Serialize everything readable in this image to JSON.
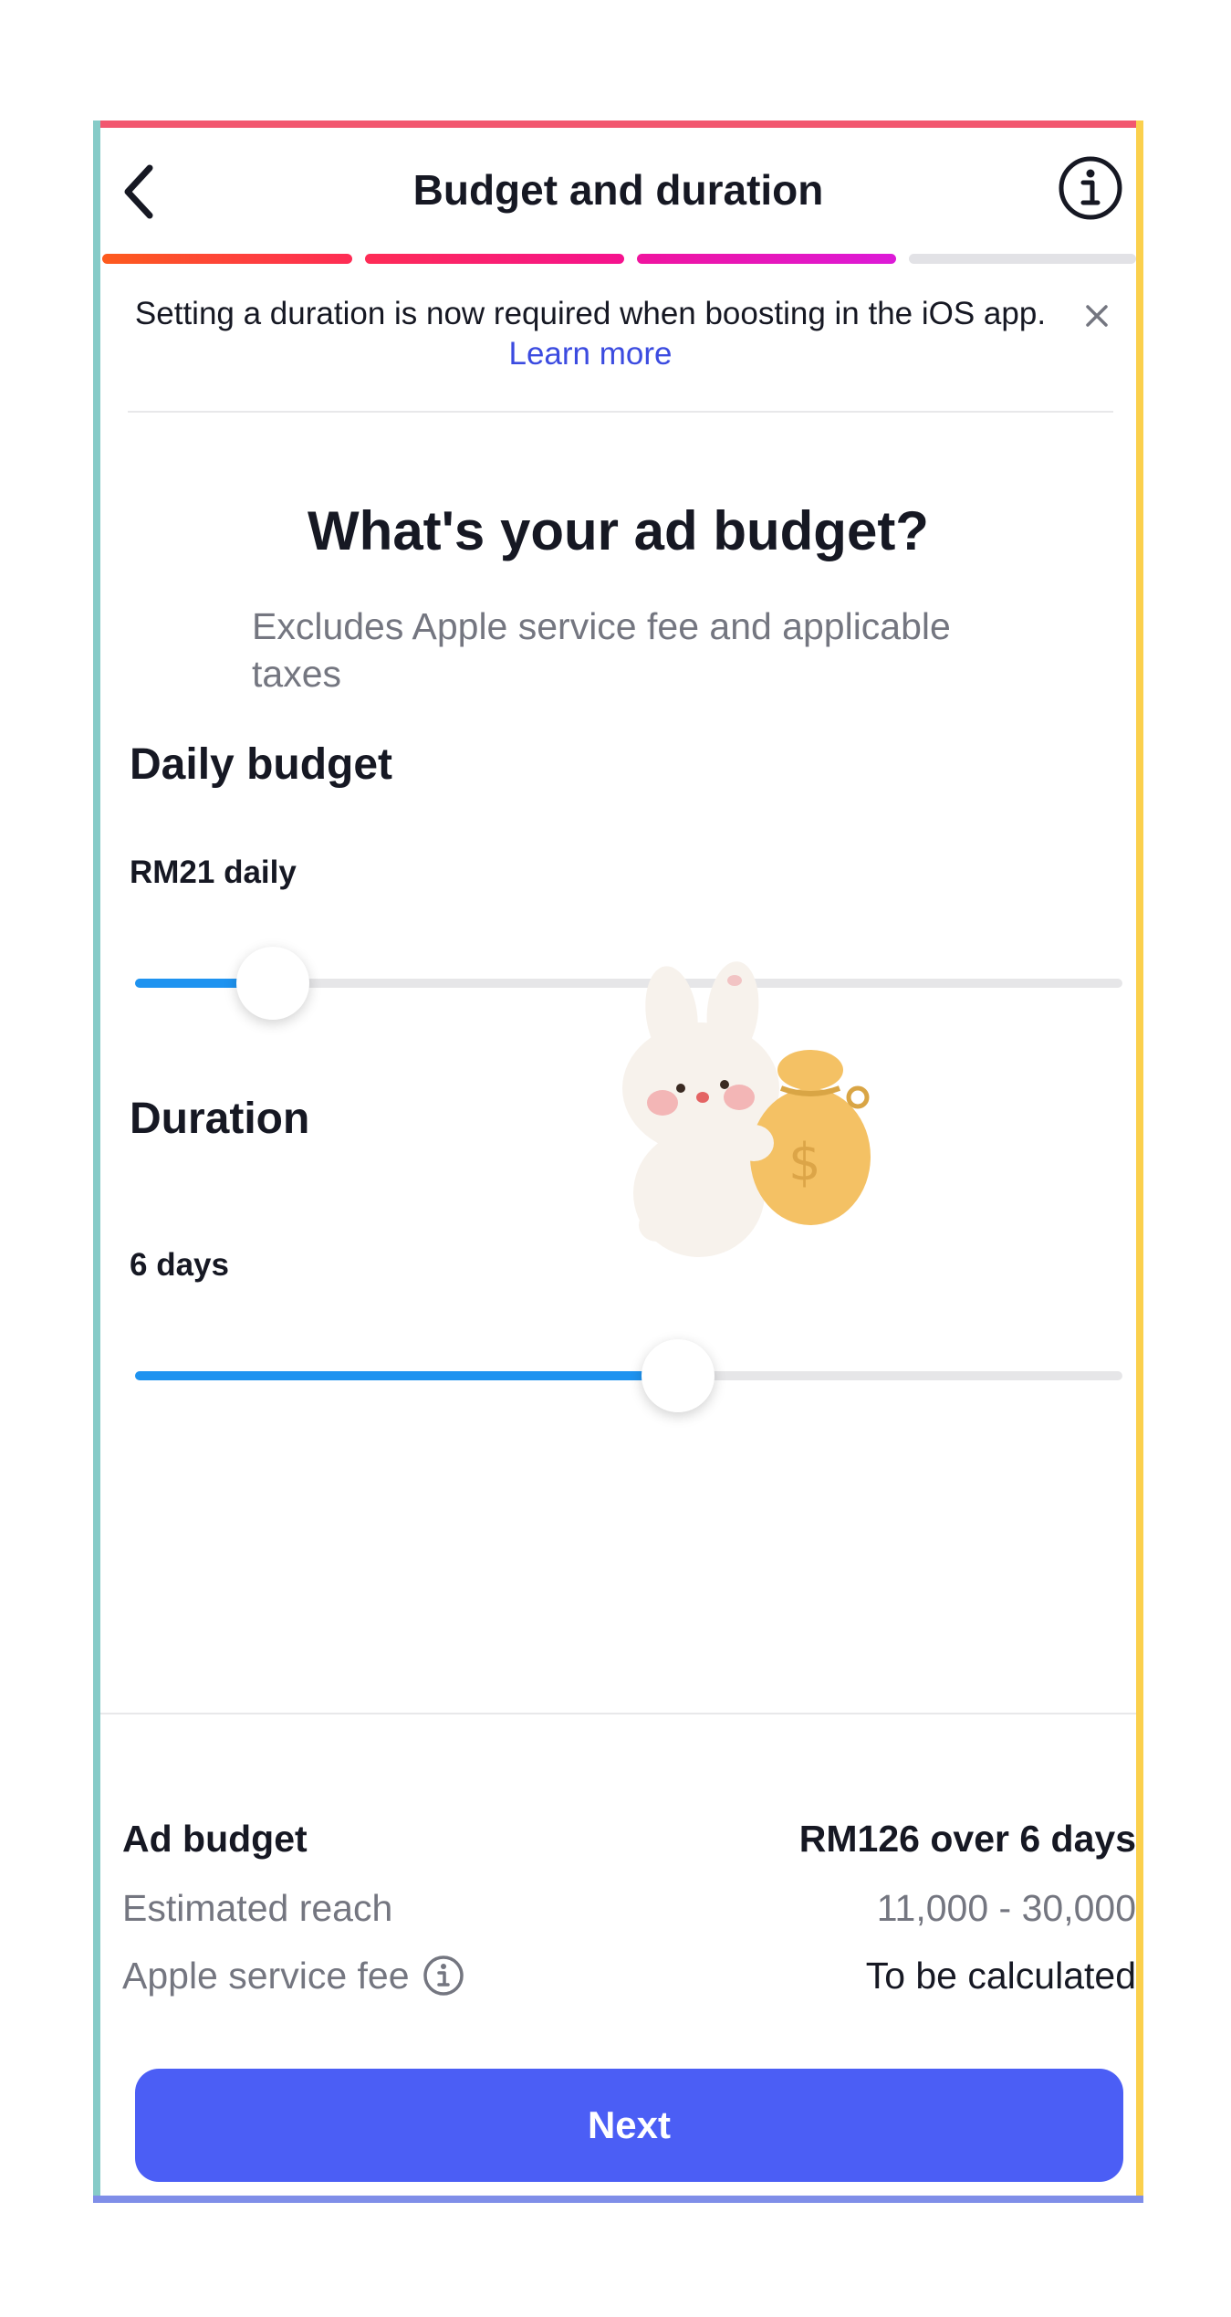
{
  "header": {
    "title": "Budget and duration",
    "back_icon": "chevron-left-icon",
    "info_icon": "info-circle-icon"
  },
  "progress": {
    "steps_total": 4,
    "steps_completed": 3
  },
  "banner": {
    "text": "Setting a duration is now required when boosting in the iOS app.",
    "link": "Learn more",
    "close_icon": "close-icon"
  },
  "question": {
    "title": "What's your ad budget?",
    "subtitle": "Excludes Apple service fee and applicable taxes"
  },
  "daily_budget": {
    "label": "Daily budget",
    "value_text": "RM21 daily",
    "slider_fraction": 0.14
  },
  "duration": {
    "label": "Duration",
    "value_text": "6 days",
    "slider_fraction": 0.55
  },
  "summary": {
    "ad_budget_label": "Ad budget",
    "ad_budget_value": "RM126 over 6 days",
    "reach_label": "Estimated reach",
    "reach_value": "11,000 - 30,000",
    "fee_label": "Apple service fee",
    "fee_value": "To be calculated"
  },
  "next_button": "Next",
  "colors": {
    "accent": "#4b5ef5",
    "link": "#3b4be0",
    "slider_fill": "#1e93f0",
    "progress_1": "#fd5b1d",
    "progress_2": "#fe2c6a",
    "progress_3": "#e817c8",
    "progress_inactive": "#e2e2e6"
  }
}
